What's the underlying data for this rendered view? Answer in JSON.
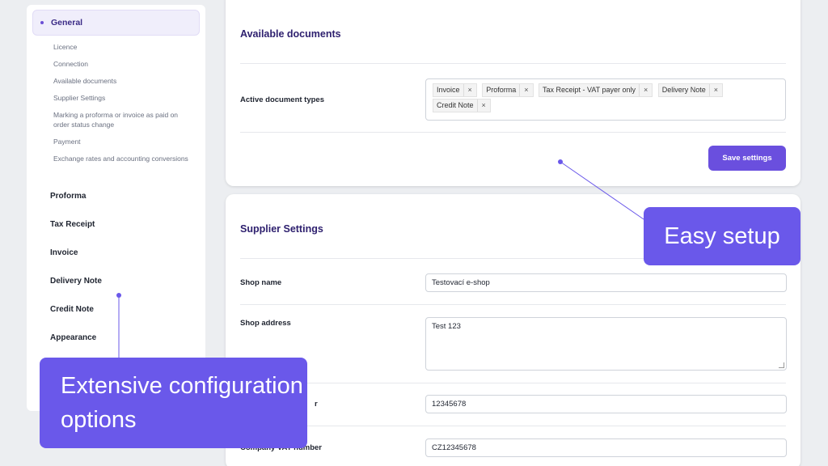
{
  "sidebar": {
    "active_item": "General",
    "sub_items": [
      "Licence",
      "Connection",
      "Available documents",
      "Supplier Settings",
      "Marking a proforma or invoice as paid on order status change",
      "Payment",
      "Exchange rates and accounting conversions"
    ],
    "sections": [
      "Proforma",
      "Tax Receipt",
      "Invoice",
      "Delivery Note",
      "Credit Note",
      "Appearance"
    ]
  },
  "available_documents": {
    "title": "Available documents",
    "active_types_label": "Active document types",
    "tags": [
      "Invoice",
      "Proforma",
      "Tax Receipt - VAT payer only",
      "Delivery Note",
      "Credit Note"
    ],
    "remove_symbol": "×",
    "save_label": "Save settings"
  },
  "supplier_settings": {
    "title": "Supplier Settings",
    "shop_name_label": "Shop name",
    "shop_name_value": "Testovací e-shop",
    "shop_address_label": "Shop address",
    "shop_address_value": "Test 123",
    "company_id_label": "r",
    "company_id_value": "12345678",
    "company_vat_label": "Company VAT number",
    "company_vat_value": "CZ12345678"
  },
  "callouts": {
    "easy_setup": "Easy setup",
    "extensive": "Extensive configuration options"
  },
  "colors": {
    "accent": "#6a4fde",
    "callout": "#6a58ea",
    "title": "#2d1f6e"
  }
}
